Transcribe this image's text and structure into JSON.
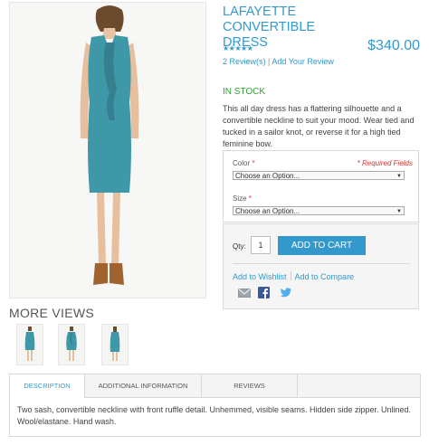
{
  "product": {
    "title": "LAFAYETTE CONVERTIBLE DRESS",
    "price": "$340.00",
    "rating_stars": "★★★★★",
    "rating": 5,
    "reviews_link": "2 Review(s)",
    "review_separator": "|",
    "add_review_link": "Add Your Review",
    "stock_status": "IN STOCK",
    "short_description": "This all day dress has a flattering silhouette and a convertible neckline to suit your mood. Wear tied and tucked in a sailor knot, or reverse it for a high tied feminine bow."
  },
  "gallery": {
    "more_views_label": "MORE VIEWS",
    "thumbnails": [
      "thumb-front",
      "thumb-side",
      "thumb-back"
    ]
  },
  "options": {
    "color_label": "Color",
    "required_star": "*",
    "required_fields_note": "* Required Fields",
    "color_select_value": "Choose an Option...",
    "size_label": "Size",
    "size_select_value": "Choose an Option..."
  },
  "cart": {
    "qty_label": "Qty:",
    "qty_value": "1",
    "add_to_cart_label": "ADD TO CART",
    "wishlist_link": "Add to Wishlist",
    "compare_link": "Add to Compare",
    "share_icons": [
      "email-icon",
      "facebook-icon",
      "twitter-icon"
    ]
  },
  "tabs": {
    "items": [
      {
        "label": "DESCRIPTION",
        "active": true
      },
      {
        "label": "ADDITIONAL INFORMATION",
        "active": false
      },
      {
        "label": "REVIEWS",
        "active": false
      }
    ],
    "description_text": "Two sash, convertible neckline with front ruffle detail. Unhemmed, visible seams. Hidden side zipper. Unlined. Wool/elastane. Hand wash."
  },
  "colors": {
    "accent": "#3399cc",
    "in_stock": "#33a033",
    "required": "#df2f2f",
    "dress": "#3f98a8"
  }
}
